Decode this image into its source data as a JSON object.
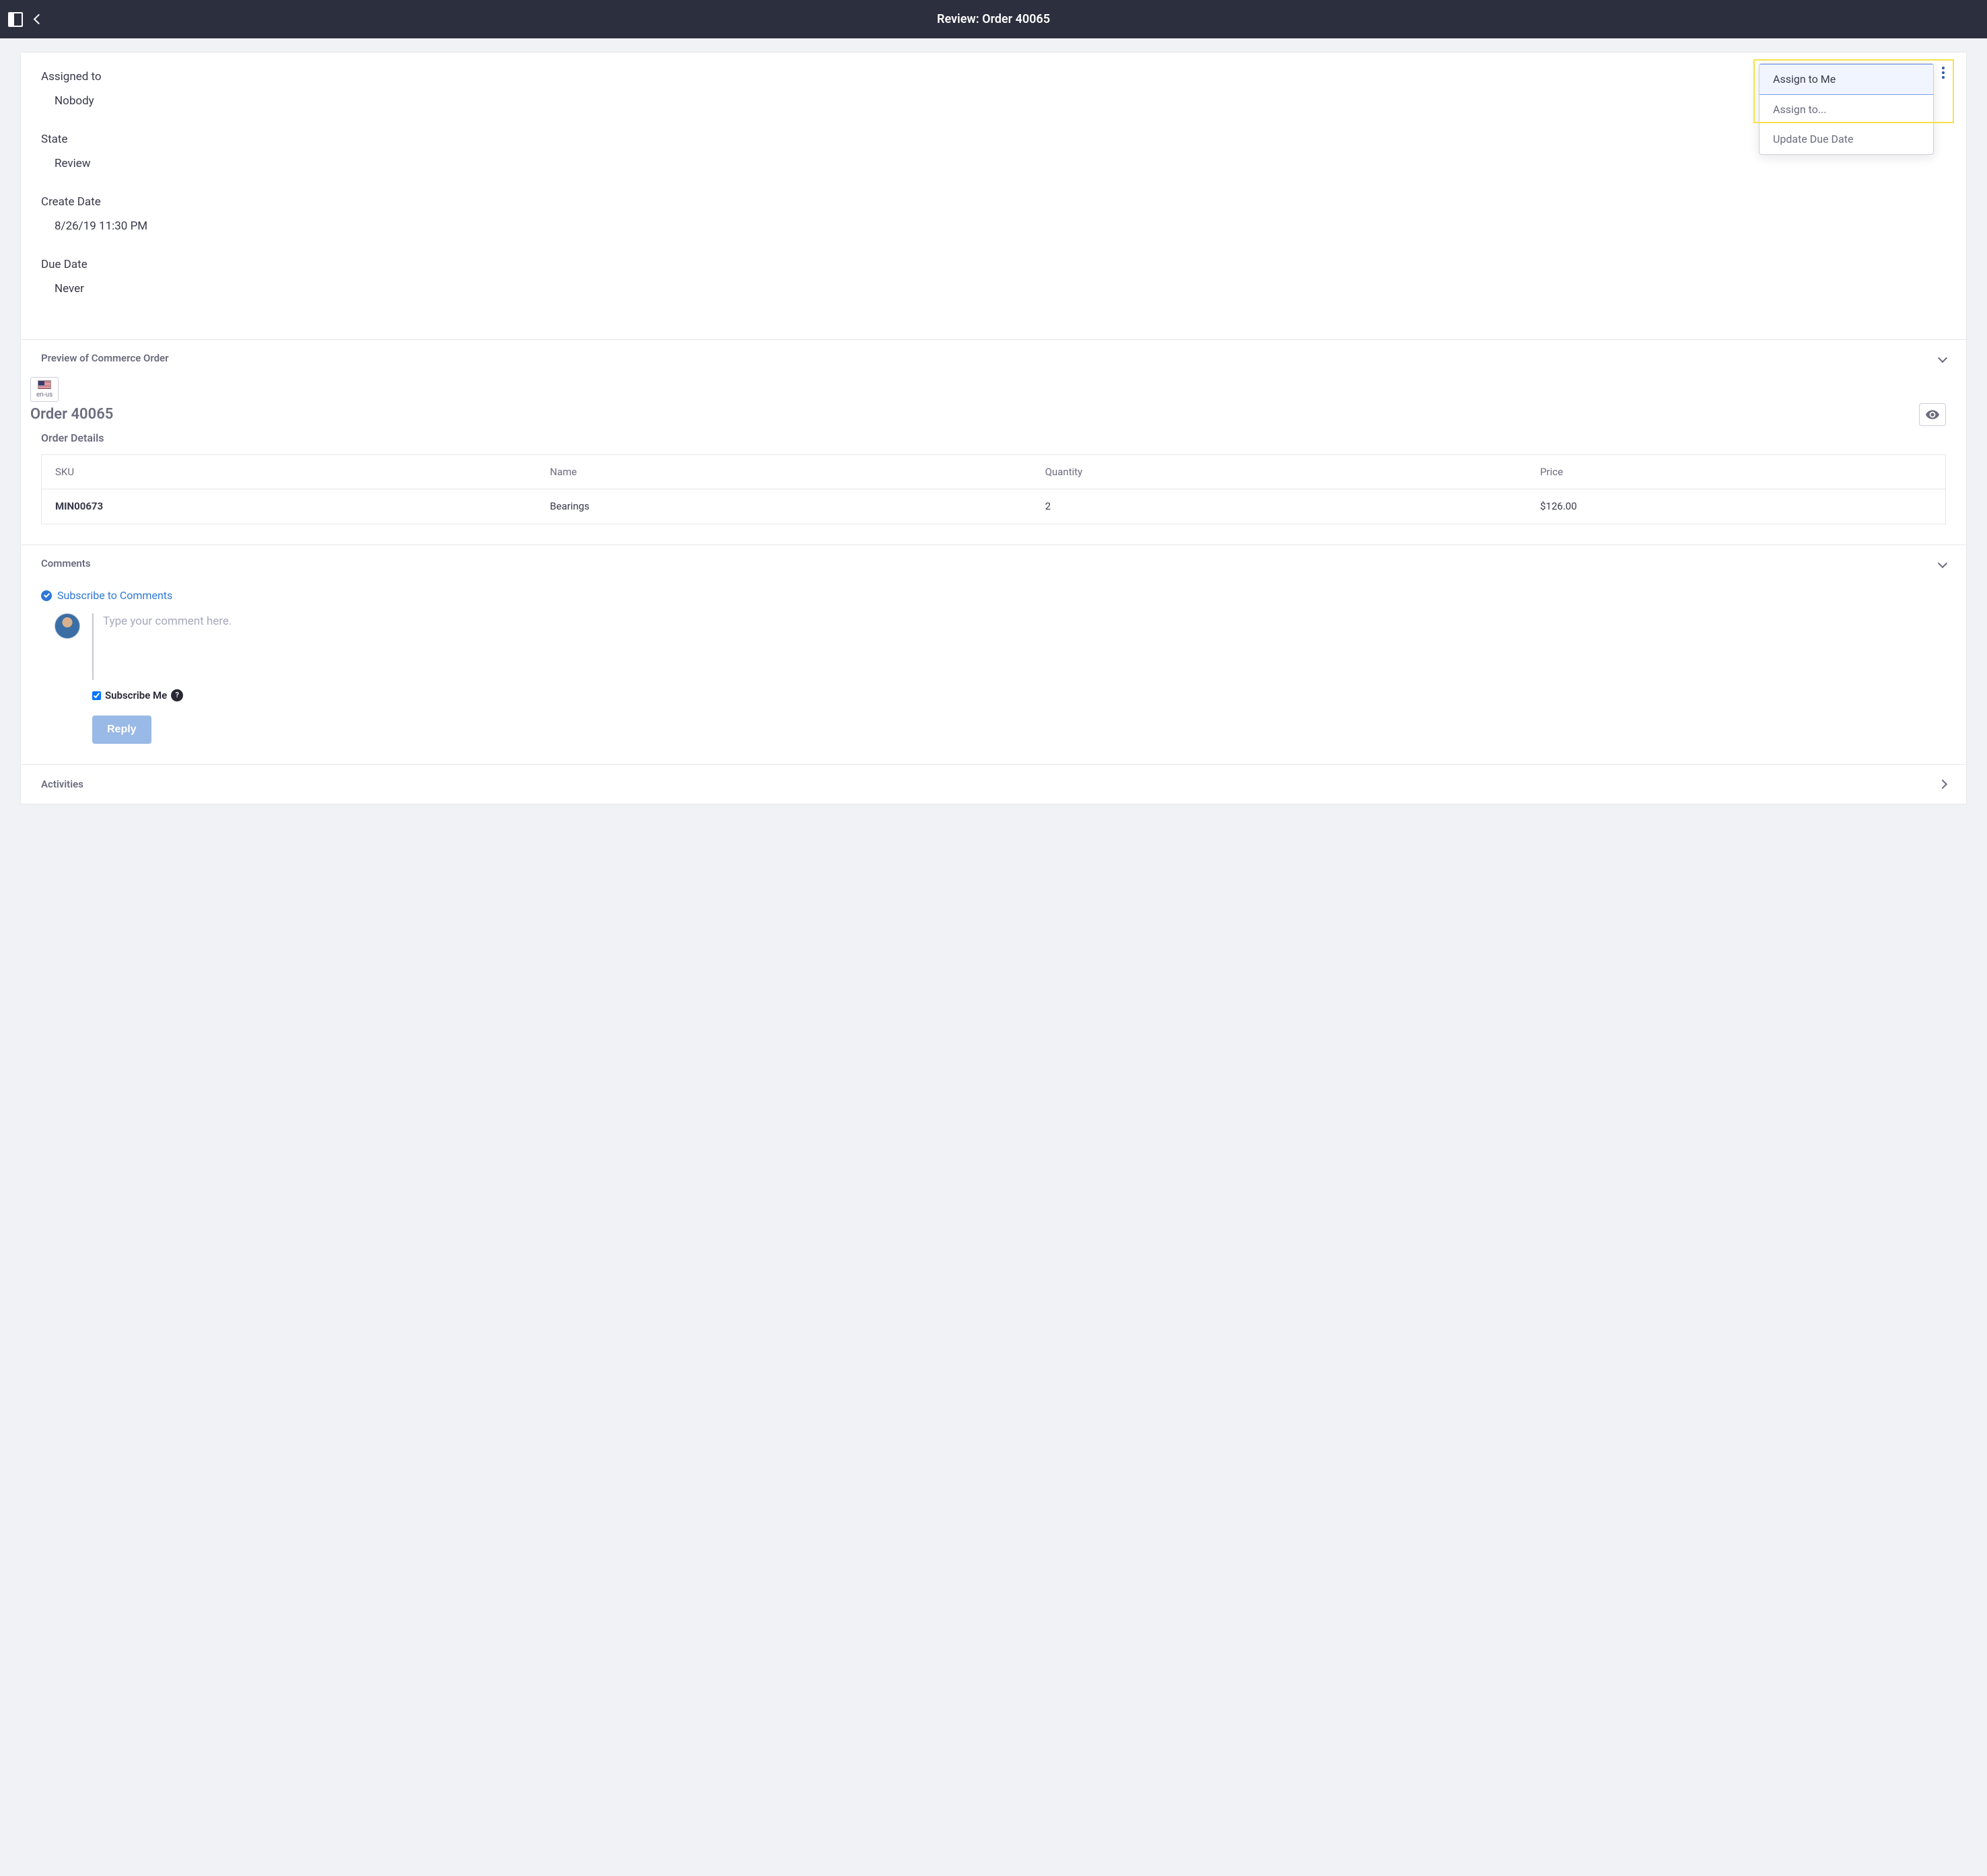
{
  "header": {
    "title": "Review: Order 40065"
  },
  "details": {
    "assigned_to_label": "Assigned to",
    "assigned_to_value": "Nobody",
    "state_label": "State",
    "state_value": "Review",
    "create_date_label": "Create Date",
    "create_date_value": "8/26/19 11:30 PM",
    "due_date_label": "Due Date",
    "due_date_value": "Never"
  },
  "actions_menu": {
    "assign_to_me": "Assign to Me",
    "assign_to": "Assign to...",
    "update_due_date": "Update Due Date"
  },
  "preview": {
    "section_title": "Preview of Commerce Order",
    "locale": "en-us",
    "heading": "Order 40065",
    "subheading": "Order Details",
    "columns": {
      "sku": "SKU",
      "name": "Name",
      "qty": "Quantity",
      "price": "Price"
    },
    "rows": [
      {
        "sku": "MIN00673",
        "name": "Bearings",
        "qty": "2",
        "price": "$126.00"
      }
    ]
  },
  "comments": {
    "section_title": "Comments",
    "subscribe_link": "Subscribe to Comments",
    "placeholder": "Type your comment here.",
    "subscribe_me": "Subscribe Me",
    "reply": "Reply"
  },
  "activities": {
    "section_title": "Activities"
  }
}
